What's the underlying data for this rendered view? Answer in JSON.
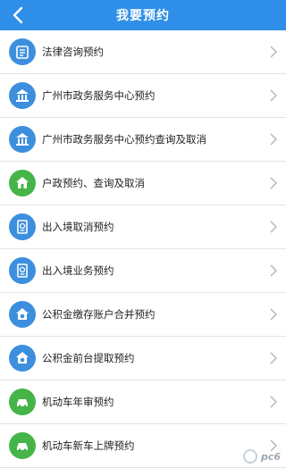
{
  "header": {
    "title": "我要预约"
  },
  "items": [
    {
      "label": "法律咨询预约",
      "icon": "law-icon",
      "color": "#3d8fde"
    },
    {
      "label": "广州市政务服务中心预约",
      "icon": "building-icon",
      "color": "#3d8fde"
    },
    {
      "label": "广州市政务服务中心预约查询及取消",
      "icon": "building-icon",
      "color": "#3d8fde"
    },
    {
      "label": "户政预约、查询及取消",
      "icon": "household-icon",
      "color": "#45b449"
    },
    {
      "label": "出入境取消预约",
      "icon": "passport-icon",
      "color": "#3d8fde"
    },
    {
      "label": "出入境业务预约",
      "icon": "passport-icon",
      "color": "#3d8fde"
    },
    {
      "label": "公积金缴存账户合并预约",
      "icon": "fund-icon",
      "color": "#3d8fde"
    },
    {
      "label": "公积金前台提取预约",
      "icon": "fund-icon",
      "color": "#3d8fde"
    },
    {
      "label": "机动车年审预约",
      "icon": "car-icon",
      "color": "#45b449"
    },
    {
      "label": "机动车新车上牌预约",
      "icon": "car-icon",
      "color": "#45b449"
    }
  ],
  "watermark": "pc6"
}
